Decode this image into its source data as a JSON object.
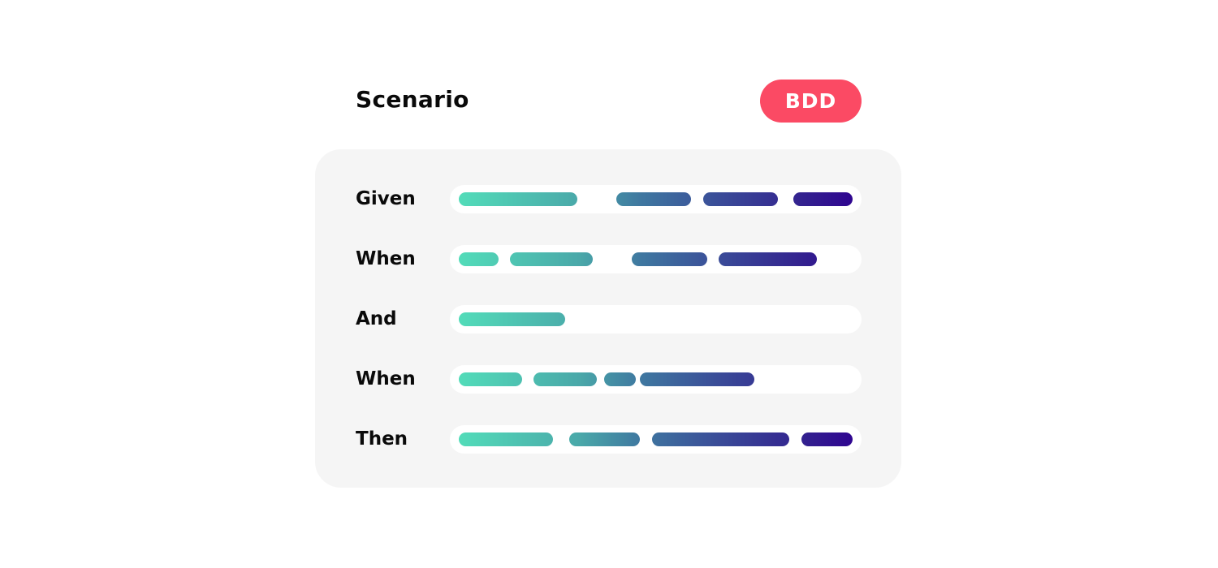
{
  "header": {
    "title": "Scenario",
    "badge": "BDD"
  },
  "colors": {
    "badge_bg": "#fb4a64",
    "gradient_start": "#52dcb9",
    "gradient_end": "#2e0090",
    "card_bg": "#f5f5f5"
  },
  "rows": [
    {
      "label": "Given",
      "segments": [
        [
          0.0,
          0.3
        ],
        [
          0.4,
          0.59
        ],
        [
          0.62,
          0.81
        ],
        [
          0.85,
          1.0
        ]
      ]
    },
    {
      "label": "When",
      "segments": [
        [
          0.0,
          0.1
        ],
        [
          0.13,
          0.34
        ],
        [
          0.44,
          0.63
        ],
        [
          0.66,
          0.91
        ]
      ]
    },
    {
      "label": "And",
      "segments": [
        [
          0.0,
          0.27
        ]
      ]
    },
    {
      "label": "When",
      "segments": [
        [
          0.0,
          0.16
        ],
        [
          0.19,
          0.35
        ],
        [
          0.37,
          0.45
        ],
        [
          0.46,
          0.75
        ]
      ]
    },
    {
      "label": "Then",
      "segments": [
        [
          0.0,
          0.24
        ],
        [
          0.28,
          0.46
        ],
        [
          0.49,
          0.84
        ],
        [
          0.87,
          1.0
        ]
      ]
    }
  ]
}
